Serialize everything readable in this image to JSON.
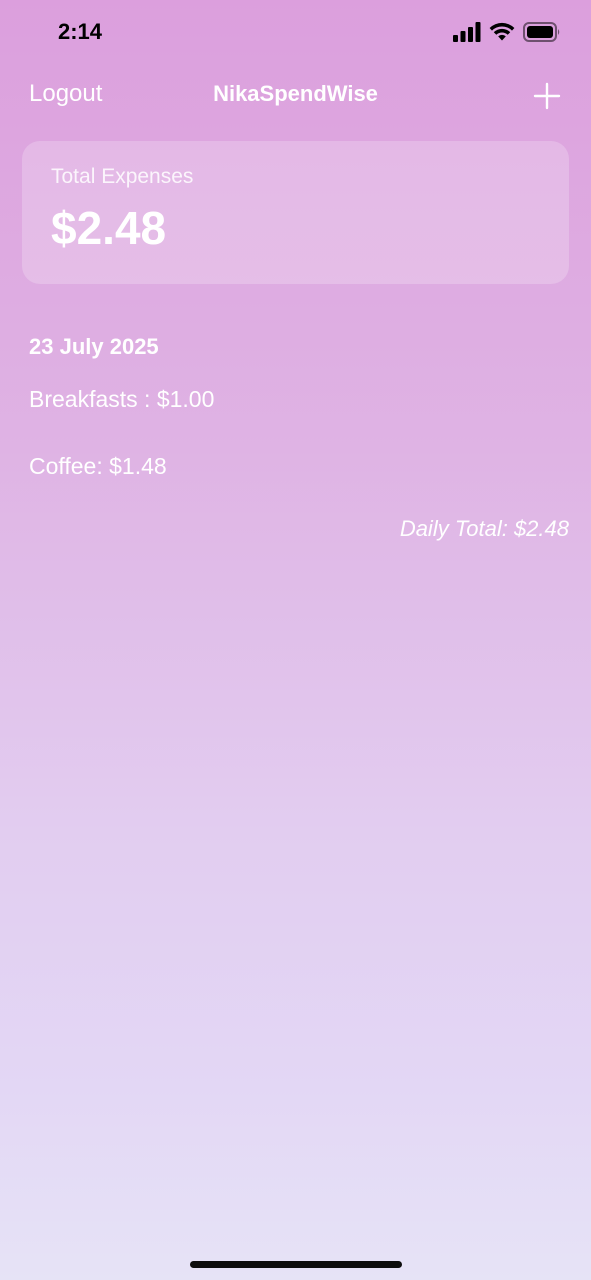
{
  "status_bar": {
    "time": "2:14",
    "icons": [
      "cellular-signal-icon",
      "wifi-icon",
      "battery-icon"
    ]
  },
  "nav": {
    "logout_label": "Logout",
    "title": "NikaSpendWise",
    "add_icon": "plus-icon"
  },
  "summary": {
    "label": "Total Expenses",
    "value": "$2.48"
  },
  "days": [
    {
      "date": "23 July 2025",
      "items": [
        {
          "text": "Breakfasts : $1.00"
        },
        {
          "text": "Coffee: $1.48"
        }
      ],
      "daily_total": "Daily Total: $2.48"
    }
  ],
  "colors": {
    "gradient_top": "#DC9FDD",
    "gradient_bottom": "#E6E3F6",
    "text": "#FFFFFF"
  }
}
